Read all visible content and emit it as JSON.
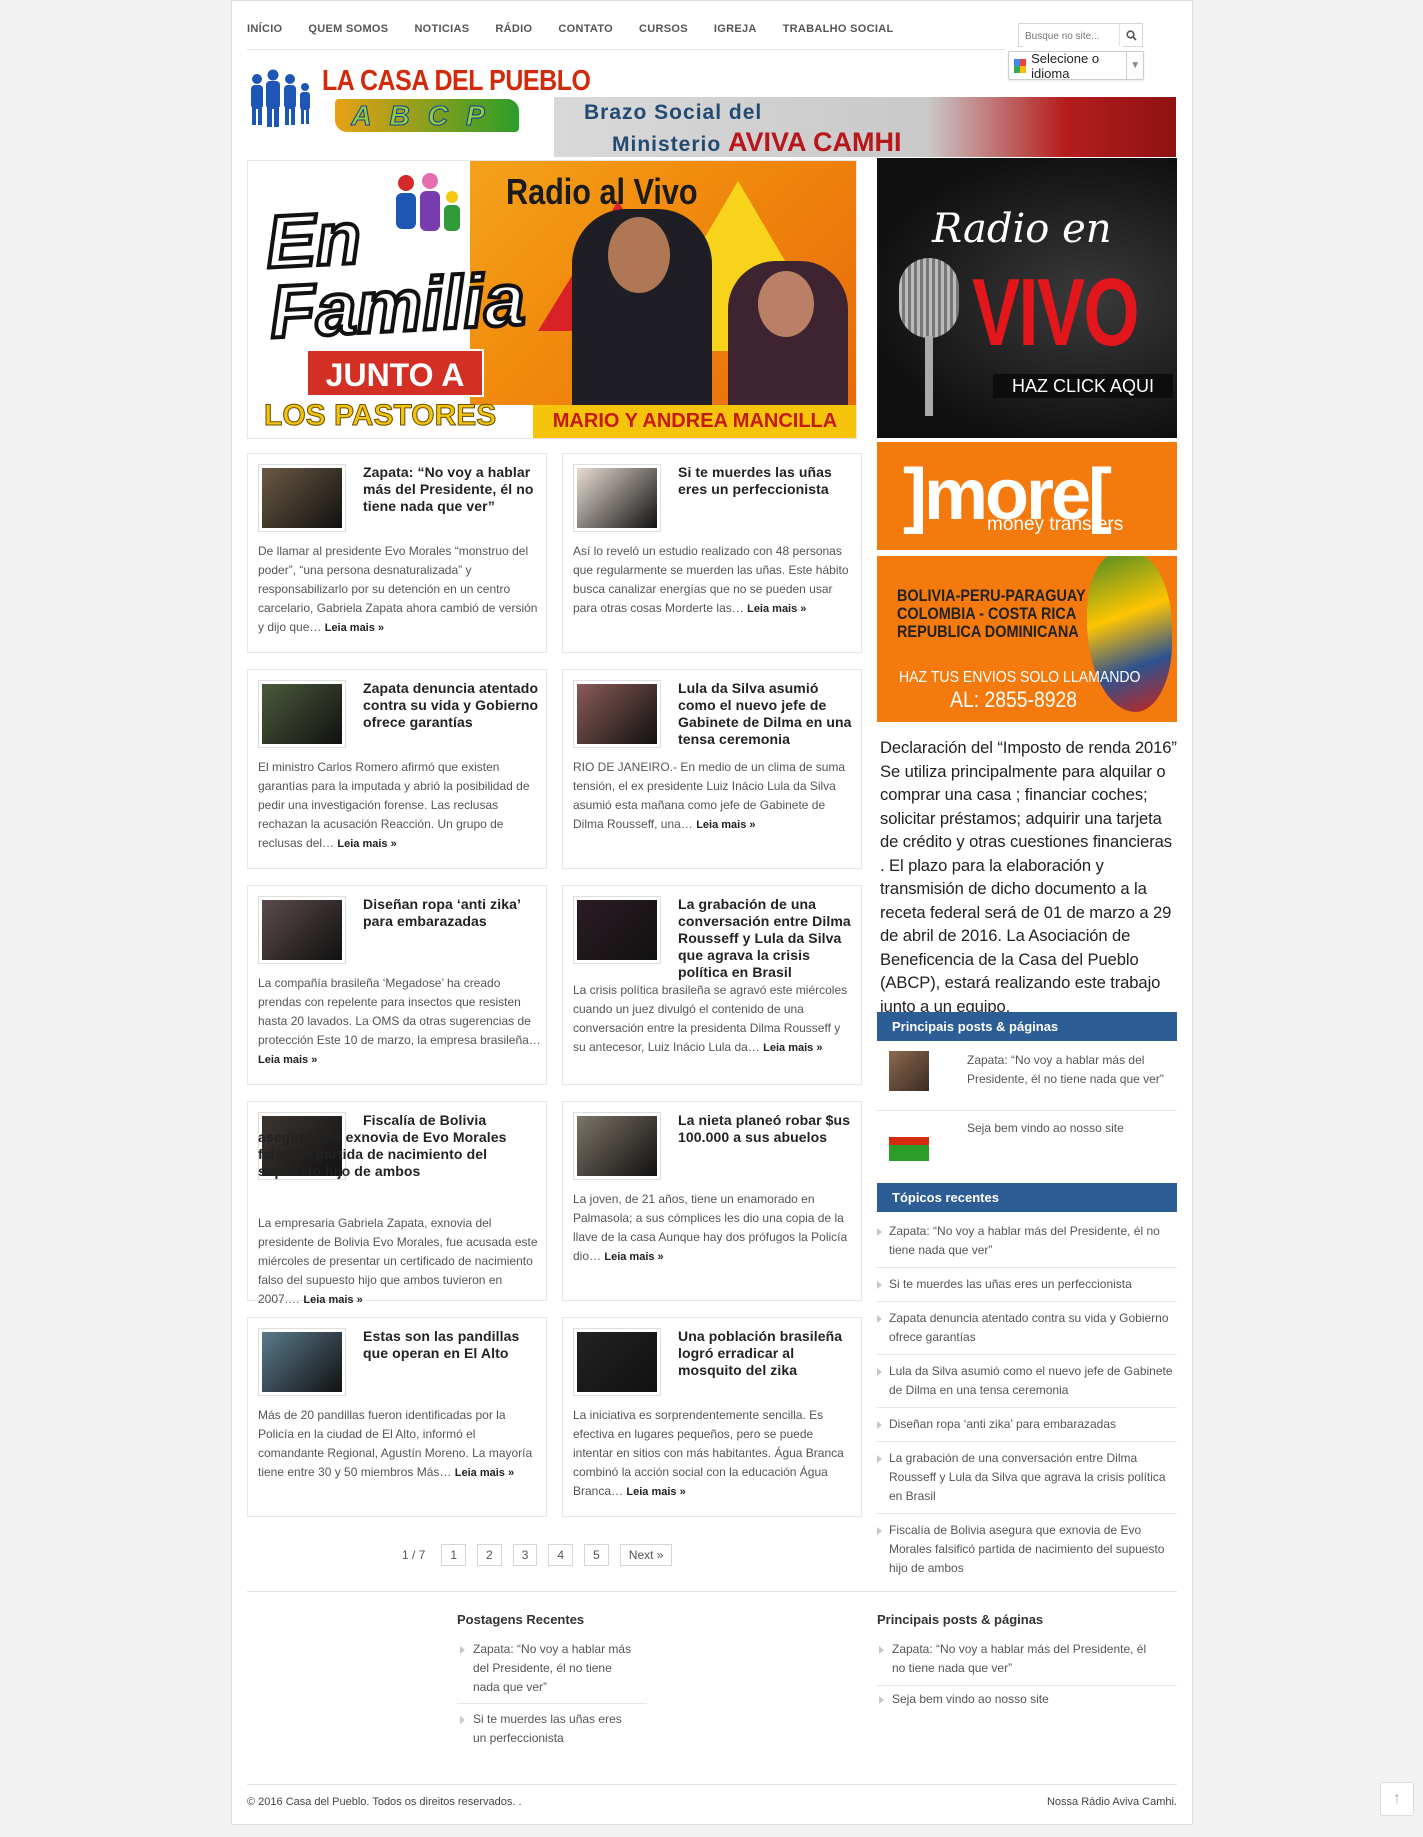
{
  "nav": {
    "items": [
      "INÍCIO",
      "QUEM SOMOS",
      "NOTICIAS",
      "RÁDIO",
      "CONTATO",
      "CURSOS",
      "IGREJA",
      "TRABALHO SOCIAL"
    ]
  },
  "search": {
    "placeholder": "Busque no site...",
    "icon": "search-icon"
  },
  "language": {
    "label": "Selecione o idioma"
  },
  "logo": {
    "title": "LA CASA DEL PUEBLO",
    "sub": "ABCP"
  },
  "banner": {
    "line1": "Brazo Social del",
    "line2_prefix": "Ministerio",
    "line2_name": "AVIVA CAMHI"
  },
  "hero": {
    "radio": "Radio al Vivo",
    "title1": "En",
    "title2": "Familia",
    "junto": "JUNTO A",
    "pastores": "LOS PASTORES",
    "names": "MARIO Y ANDREA MANCILLA"
  },
  "posts": [
    {
      "title": "Zapata: “No voy a hablar más del Presidente, él no tiene nada que ver”",
      "excerpt": "De llamar al presidente Evo Morales “monstruo del poder”, “una persona desnaturalizada” y responsabilizarlo por su detención en un centro carcelario, Gabriela Zapata ahora cambió de versión y dijo que…",
      "more": "Leia mais »",
      "thumb_color": "#6b5a43"
    },
    {
      "title": "Si te muerdes las uñas eres un perfeccionista",
      "excerpt": "Así lo reveló un estudio realizado con 48 personas que regularmente se muerden las uñas. Este hábito busca canalizar energías que no se pueden usar para otras cosas Morderte las…",
      "more": "Leia mais »",
      "thumb_color": "#e8ddd4"
    },
    {
      "title": "Zapata denuncia atentado contra su vida y Gobierno ofrece garantías",
      "excerpt": "El ministro Carlos Romero afirmó que existen garantías para la imputada y abrió la posibilidad de pedir una investigación forense. Las reclusas rechazan la acusación Reacción. Un grupo de reclusas del…",
      "more": "Leia mais »",
      "thumb_color": "#4d5a3c"
    },
    {
      "title": "Lula da Silva asumió como el nuevo jefe de Gabinete de Dilma en una tensa ceremonia",
      "excerpt": "RIO DE JANEIRO.- En medio de un clima de suma tensión, el ex presidente Luiz Inácio Lula da Silva asumió esta mañana como jefe de Gabinete de Dilma Rousseff, una…",
      "more": "Leia mais »",
      "thumb_color": "#8a5b57"
    },
    {
      "title": "Diseñan ropa ‘anti zika’ para embarazadas",
      "excerpt": "La compañía brasileña ‘Megadose’ ha creado prendas con repelente para insectos que resisten hasta 20 lavados. La OMS da otras sugerencias de protección Este 10 de marzo, la empresa brasileña…",
      "more": "Leia mais »",
      "thumb_color": "#5b4b4b"
    },
    {
      "title": "La grabación de una conversación entre Dilma Rousseff y Lula da Silva que agrava la crisis política en Brasil",
      "excerpt": "La crisis política brasileña se agravó este miércoles cuando un juez divulgó el contenido de una conversación entre la presidenta Dilma Rousseff y su antecesor, Luiz Inácio Lula da…",
      "more": "Leia mais »",
      "thumb_color": "#2b1c24"
    },
    {
      "title": "Fiscalía de Bolivia asegura que exnovia de Evo Morales falsificó partida de nacimiento del supuesto hijo de ambos",
      "excerpt": "La empresaria Gabriela Zapata, exnovia del presidente de Bolivia Evo Morales, fue acusada este miércoles de presentar un certificado de nacimiento falso del supuesto hijo que ambos tuvieron en 2007.…",
      "more": "Leia mais »",
      "thumb_color": "#3b3531"
    },
    {
      "title": "La nieta planeó robar $us 100.000 a sus abuelos",
      "excerpt": "La joven, de 21 años, tiene un enamorado en Palmasola; a sus cómplices les dio una copia de la llave de la casa Aunque hay dos prófugos la Policía dio…",
      "more": "Leia mais »",
      "thumb_color": "#7d7467"
    },
    {
      "title": "Estas son las pandillas que operan en El Alto",
      "excerpt": "Más de 20 pandillas fueron identificadas por la Policía en la ciudad de El Alto, informó el comandante Regional, Agustín Moreno. La mayoría tiene entre 30 y 50 miembros Más…",
      "more": "Leia mais »",
      "thumb_color": "#5a7a8c"
    },
    {
      "title": "Una población brasileña logró erradicar al mosquito del zika",
      "excerpt": "La iniciativa es sorprendentemente sencilla. Es efectiva en lugares pequeños, pero se puede intentar en sitios con más habitantes. Água Branca combinó la acción social con la educación Água Branca…",
      "more": "Leia mais »",
      "thumb_color": "#222222"
    }
  ],
  "pagination": {
    "info": "1 / 7",
    "pages": [
      "1",
      "2",
      "3",
      "4",
      "5"
    ],
    "next": "Next »"
  },
  "sidebar": {
    "radio_ad": {
      "line1": "Radio en",
      "line2": "VIVO",
      "cta": "HAZ CLICK AQUI"
    },
    "more_ad": {
      "logo": "]more[",
      "tagline": "money transfers",
      "countries": [
        "BOLIVIA-PERU-PARAGUAY",
        "COLOMBIA - COSTA RICA",
        "REPUBLICA DOMINICANA"
      ],
      "cta1": "HAZ TUS ENVIOS SOLO LLAMANDO",
      "cta2": "AL: 2855-8928"
    },
    "declaracion": "Declaración del “Imposto de renda 2016” Se utiliza principalmente para alquilar o comprar una casa ; financiar coches; solicitar préstamos; adquirir una tarjeta de crédito y otras cuestiones financieras . El plazo para la elaboración y transmisión de dicho documento a la receta federal será de 01 de marzo a 29 de abril de 2016. La Asociación de Beneficencia de la Casa del Pueblo (ABCP), estará realizando este trabajo junto a un equipo.",
    "top_posts_title": "Principais posts & páginas",
    "top_posts": [
      "Zapata: “No voy a hablar más del Presidente, él no tiene nada que ver”",
      "Seja bem vindo ao nosso site"
    ],
    "recent_title": "Tópicos recentes",
    "recent": [
      "Zapata: “No voy a hablar más del Presidente, él no tiene nada que ver”",
      "Si te muerdes las uñas eres un perfeccionista",
      "Zapata denuncia atentado contra su vida y Gobierno ofrece garantías",
      "Lula da Silva asumió como el nuevo jefe de Gabinete de Dilma en una tensa ceremonia",
      "Diseñan ropa ‘anti zika’ para embarazadas",
      "La grabación de una conversación entre Dilma Rousseff y Lula da Silva que agrava la crisis política en Brasil",
      "Fiscalía de Bolivia asegura que exnovia de Evo Morales falsificó partida de nacimiento del supuesto hijo de ambos"
    ]
  },
  "footer": {
    "recent_title": "Postagens Recentes",
    "recent": [
      "Zapata: “No voy a hablar más del Presidente, él no tiene nada que ver”",
      "Si te muerdes las uñas eres un perfeccionista"
    ],
    "top_title": "Principais posts & páginas",
    "top": [
      "Zapata: “No voy a hablar más del Presidente, él no tiene nada que ver”",
      "Seja bem vindo ao nosso site"
    ],
    "copyright": "© 2016 Casa del Pueblo. Todos os direitos reservados. .",
    "radio_link": "Nossa Rádio Aviva Camhi."
  },
  "colors": {
    "widget_title_bg": "#2d5d95",
    "logo_red": "#d42a0c",
    "more_orange": "#f47a0d"
  }
}
